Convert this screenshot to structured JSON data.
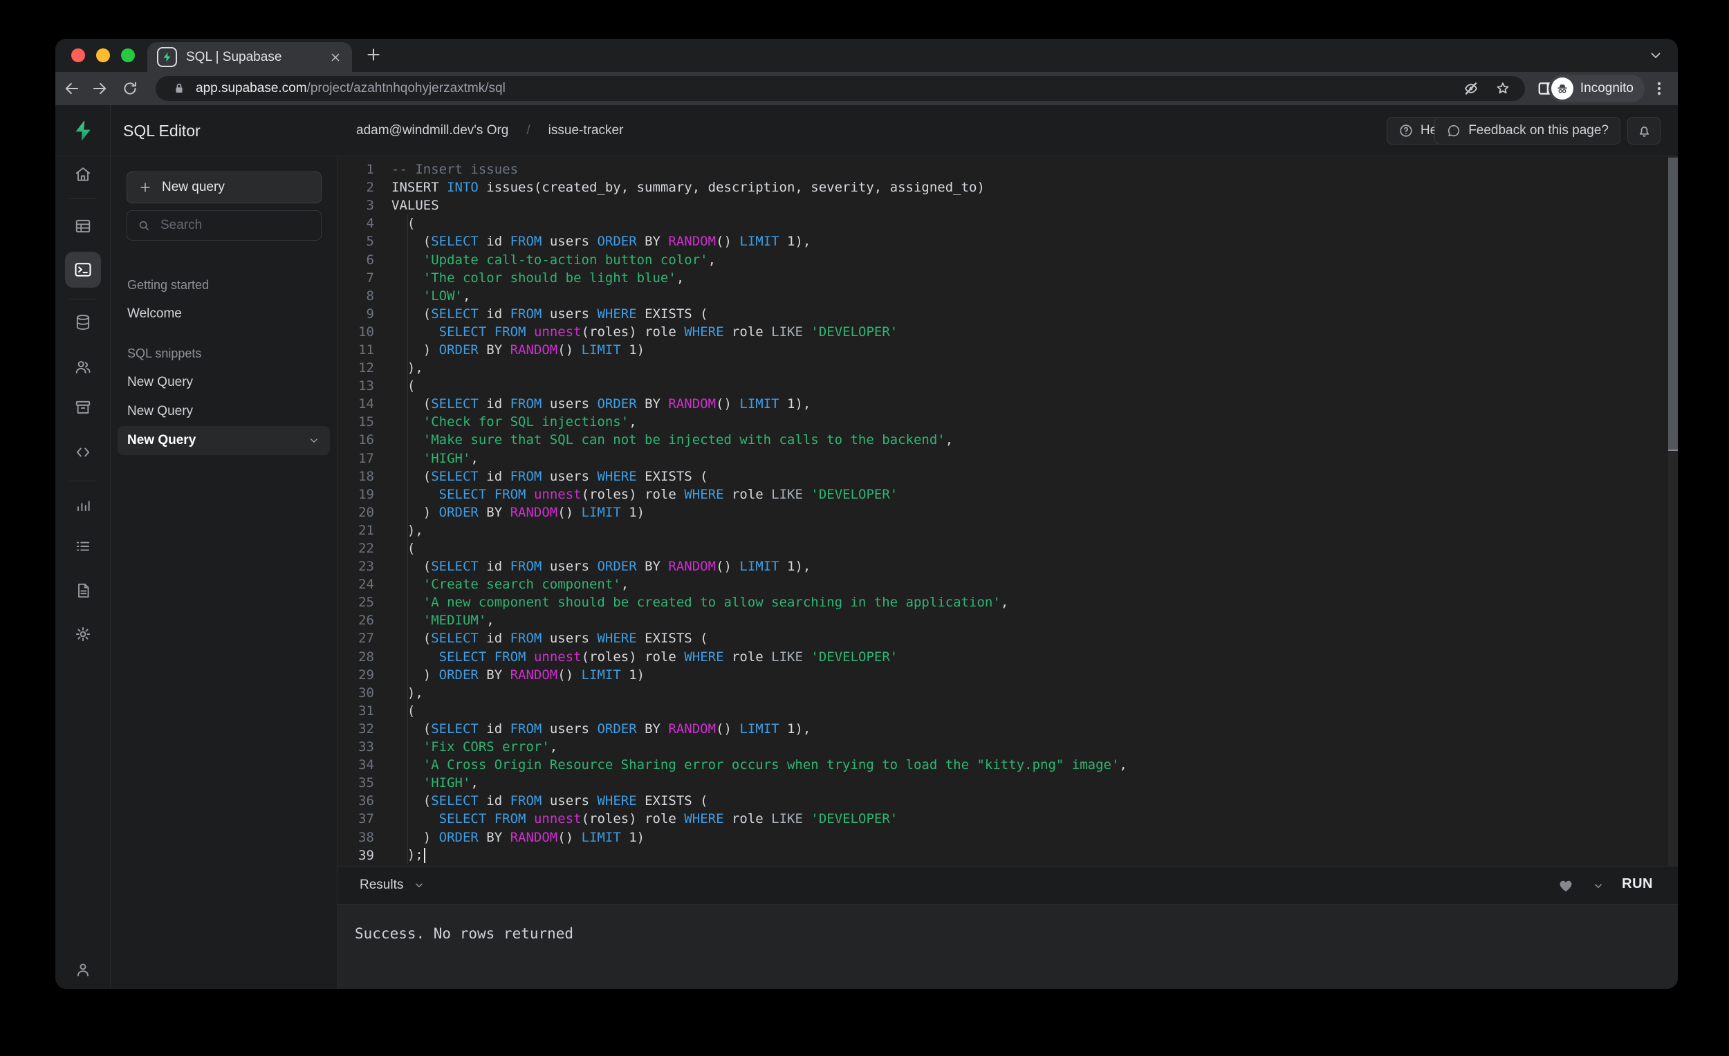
{
  "colors": {
    "brand_green": "#3ECF8E",
    "syntax_keyword": "#3E9EE6",
    "syntax_function": "#D02ED0",
    "syntax_string": "#2EB573",
    "syntax_comment": "#6B7480",
    "traffic_red": "#FF5F57",
    "traffic_yellow": "#FEBC2E",
    "traffic_green": "#28C840"
  },
  "browser": {
    "tab_title": "SQL | Supabase",
    "url_domain": "app.supabase.com",
    "url_path": "/project/azahtnhqohyjerzaxtmk/sql",
    "incognito_label": "Incognito",
    "icons": [
      "back-icon",
      "forward-icon",
      "reload-icon",
      "lock-icon",
      "eye-off-icon",
      "star-icon",
      "side-panel-icon",
      "incognito-icon",
      "kebab-menu-icon",
      "new-tab-icon",
      "tab-search-icon",
      "close-icon",
      "supabase-favicon"
    ]
  },
  "header": {
    "title": "SQL Editor",
    "breadcrumb_org": "adam@windmill.dev's Org",
    "breadcrumb_sep": "/",
    "breadcrumb_project": "issue-tracker",
    "help_label": "Help",
    "feedback_label": "Feedback on this page?",
    "icons": [
      "supabase-logo",
      "help-circle-icon",
      "chat-bubble-icon",
      "bell-icon"
    ]
  },
  "icon_rail": {
    "icons": [
      "home-icon",
      "table-editor-icon",
      "sql-editor-icon",
      "database-icon",
      "auth-users-icon",
      "storage-icon",
      "edge-functions-icon",
      "reports-icon",
      "logs-icon",
      "api-docs-icon",
      "settings-icon",
      "account-icon"
    ],
    "active": "sql-editor-icon"
  },
  "sidebar": {
    "new_query_label": "New query",
    "search_placeholder": "Search",
    "sections": [
      {
        "label": "Getting started",
        "items": [
          {
            "label": "Welcome",
            "active": false
          }
        ]
      },
      {
        "label": "SQL snippets",
        "items": [
          {
            "label": "New Query",
            "active": false
          },
          {
            "label": "New Query",
            "active": false
          },
          {
            "label": "New Query",
            "active": true
          }
        ]
      }
    ]
  },
  "editor": {
    "cursor_line": 39,
    "lines": [
      [
        [
          "c",
          "-- Insert issues"
        ]
      ],
      [
        [
          "p",
          "INSERT "
        ],
        [
          "k",
          "INTO"
        ],
        [
          "p",
          " issues(created_by, summary, description, severity, assigned_to)"
        ]
      ],
      [
        [
          "p",
          "VALUES"
        ]
      ],
      [
        [
          "p",
          "  ("
        ]
      ],
      [
        [
          "p",
          "    ("
        ],
        [
          "k",
          "SELECT"
        ],
        [
          "p",
          " id "
        ],
        [
          "k",
          "FROM"
        ],
        [
          "p",
          " users "
        ],
        [
          "k",
          "ORDER"
        ],
        [
          "p",
          " BY "
        ],
        [
          "f",
          "RANDOM"
        ],
        [
          "p",
          "() "
        ],
        [
          "k",
          "LIMIT"
        ],
        [
          "p",
          " 1),"
        ]
      ],
      [
        [
          "p",
          "    "
        ],
        [
          "s",
          "'Update call-to-action button color'"
        ],
        [
          "p",
          ","
        ]
      ],
      [
        [
          "p",
          "    "
        ],
        [
          "s",
          "'The color should be light blue'"
        ],
        [
          "p",
          ","
        ]
      ],
      [
        [
          "p",
          "    "
        ],
        [
          "s",
          "'LOW'"
        ],
        [
          "p",
          ","
        ]
      ],
      [
        [
          "p",
          "    ("
        ],
        [
          "k",
          "SELECT"
        ],
        [
          "p",
          " id "
        ],
        [
          "k",
          "FROM"
        ],
        [
          "p",
          " users "
        ],
        [
          "k",
          "WHERE"
        ],
        [
          "p",
          " EXISTS ("
        ]
      ],
      [
        [
          "p",
          "      "
        ],
        [
          "k",
          "SELECT"
        ],
        [
          "p",
          " "
        ],
        [
          "k",
          "FROM"
        ],
        [
          "p",
          " "
        ],
        [
          "f",
          "unnest"
        ],
        [
          "p",
          "(roles) role "
        ],
        [
          "k",
          "WHERE"
        ],
        [
          "p",
          " role "
        ],
        [
          "w",
          "LIKE"
        ],
        [
          "p",
          " "
        ],
        [
          "s",
          "'DEVELOPER'"
        ]
      ],
      [
        [
          "p",
          "    ) "
        ],
        [
          "k",
          "ORDER"
        ],
        [
          "p",
          " BY "
        ],
        [
          "f",
          "RANDOM"
        ],
        [
          "p",
          "() "
        ],
        [
          "k",
          "LIMIT"
        ],
        [
          "p",
          " 1)"
        ]
      ],
      [
        [
          "p",
          "  ),"
        ]
      ],
      [
        [
          "p",
          "  ("
        ]
      ],
      [
        [
          "p",
          "    ("
        ],
        [
          "k",
          "SELECT"
        ],
        [
          "p",
          " id "
        ],
        [
          "k",
          "FROM"
        ],
        [
          "p",
          " users "
        ],
        [
          "k",
          "ORDER"
        ],
        [
          "p",
          " BY "
        ],
        [
          "f",
          "RANDOM"
        ],
        [
          "p",
          "() "
        ],
        [
          "k",
          "LIMIT"
        ],
        [
          "p",
          " 1),"
        ]
      ],
      [
        [
          "p",
          "    "
        ],
        [
          "s",
          "'Check for SQL injections'"
        ],
        [
          "p",
          ","
        ]
      ],
      [
        [
          "p",
          "    "
        ],
        [
          "s",
          "'Make sure that SQL can not be injected with calls to the backend'"
        ],
        [
          "p",
          ","
        ]
      ],
      [
        [
          "p",
          "    "
        ],
        [
          "s",
          "'HIGH'"
        ],
        [
          "p",
          ","
        ]
      ],
      [
        [
          "p",
          "    ("
        ],
        [
          "k",
          "SELECT"
        ],
        [
          "p",
          " id "
        ],
        [
          "k",
          "FROM"
        ],
        [
          "p",
          " users "
        ],
        [
          "k",
          "WHERE"
        ],
        [
          "p",
          " EXISTS ("
        ]
      ],
      [
        [
          "p",
          "      "
        ],
        [
          "k",
          "SELECT"
        ],
        [
          "p",
          " "
        ],
        [
          "k",
          "FROM"
        ],
        [
          "p",
          " "
        ],
        [
          "f",
          "unnest"
        ],
        [
          "p",
          "(roles) role "
        ],
        [
          "k",
          "WHERE"
        ],
        [
          "p",
          " role "
        ],
        [
          "w",
          "LIKE"
        ],
        [
          "p",
          " "
        ],
        [
          "s",
          "'DEVELOPER'"
        ]
      ],
      [
        [
          "p",
          "    ) "
        ],
        [
          "k",
          "ORDER"
        ],
        [
          "p",
          " BY "
        ],
        [
          "f",
          "RANDOM"
        ],
        [
          "p",
          "() "
        ],
        [
          "k",
          "LIMIT"
        ],
        [
          "p",
          " 1)"
        ]
      ],
      [
        [
          "p",
          "  ),"
        ]
      ],
      [
        [
          "p",
          "  ("
        ]
      ],
      [
        [
          "p",
          "    ("
        ],
        [
          "k",
          "SELECT"
        ],
        [
          "p",
          " id "
        ],
        [
          "k",
          "FROM"
        ],
        [
          "p",
          " users "
        ],
        [
          "k",
          "ORDER"
        ],
        [
          "p",
          " BY "
        ],
        [
          "f",
          "RANDOM"
        ],
        [
          "p",
          "() "
        ],
        [
          "k",
          "LIMIT"
        ],
        [
          "p",
          " 1),"
        ]
      ],
      [
        [
          "p",
          "    "
        ],
        [
          "s",
          "'Create search component'"
        ],
        [
          "p",
          ","
        ]
      ],
      [
        [
          "p",
          "    "
        ],
        [
          "s",
          "'A new component should be created to allow searching in the application'"
        ],
        [
          "p",
          ","
        ]
      ],
      [
        [
          "p",
          "    "
        ],
        [
          "s",
          "'MEDIUM'"
        ],
        [
          "p",
          ","
        ]
      ],
      [
        [
          "p",
          "    ("
        ],
        [
          "k",
          "SELECT"
        ],
        [
          "p",
          " id "
        ],
        [
          "k",
          "FROM"
        ],
        [
          "p",
          " users "
        ],
        [
          "k",
          "WHERE"
        ],
        [
          "p",
          " EXISTS ("
        ]
      ],
      [
        [
          "p",
          "      "
        ],
        [
          "k",
          "SELECT"
        ],
        [
          "p",
          " "
        ],
        [
          "k",
          "FROM"
        ],
        [
          "p",
          " "
        ],
        [
          "f",
          "unnest"
        ],
        [
          "p",
          "(roles) role "
        ],
        [
          "k",
          "WHERE"
        ],
        [
          "p",
          " role "
        ],
        [
          "w",
          "LIKE"
        ],
        [
          "p",
          " "
        ],
        [
          "s",
          "'DEVELOPER'"
        ]
      ],
      [
        [
          "p",
          "    ) "
        ],
        [
          "k",
          "ORDER"
        ],
        [
          "p",
          " BY "
        ],
        [
          "f",
          "RANDOM"
        ],
        [
          "p",
          "() "
        ],
        [
          "k",
          "LIMIT"
        ],
        [
          "p",
          " 1)"
        ]
      ],
      [
        [
          "p",
          "  ),"
        ]
      ],
      [
        [
          "p",
          "  ("
        ]
      ],
      [
        [
          "p",
          "    ("
        ],
        [
          "k",
          "SELECT"
        ],
        [
          "p",
          " id "
        ],
        [
          "k",
          "FROM"
        ],
        [
          "p",
          " users "
        ],
        [
          "k",
          "ORDER"
        ],
        [
          "p",
          " BY "
        ],
        [
          "f",
          "RANDOM"
        ],
        [
          "p",
          "() "
        ],
        [
          "k",
          "LIMIT"
        ],
        [
          "p",
          " 1),"
        ]
      ],
      [
        [
          "p",
          "    "
        ],
        [
          "s",
          "'Fix CORS error'"
        ],
        [
          "p",
          ","
        ]
      ],
      [
        [
          "p",
          "    "
        ],
        [
          "s",
          "'A Cross Origin Resource Sharing error occurs when trying to load the \"kitty.png\" image'"
        ],
        [
          "p",
          ","
        ]
      ],
      [
        [
          "p",
          "    "
        ],
        [
          "s",
          "'HIGH'"
        ],
        [
          "p",
          ","
        ]
      ],
      [
        [
          "p",
          "    ("
        ],
        [
          "k",
          "SELECT"
        ],
        [
          "p",
          " id "
        ],
        [
          "k",
          "FROM"
        ],
        [
          "p",
          " users "
        ],
        [
          "k",
          "WHERE"
        ],
        [
          "p",
          " EXISTS ("
        ]
      ],
      [
        [
          "p",
          "      "
        ],
        [
          "k",
          "SELECT"
        ],
        [
          "p",
          " "
        ],
        [
          "k",
          "FROM"
        ],
        [
          "p",
          " "
        ],
        [
          "f",
          "unnest"
        ],
        [
          "p",
          "(roles) role "
        ],
        [
          "k",
          "WHERE"
        ],
        [
          "p",
          " role "
        ],
        [
          "w",
          "LIKE"
        ],
        [
          "p",
          " "
        ],
        [
          "s",
          "'DEVELOPER'"
        ]
      ],
      [
        [
          "p",
          "    ) "
        ],
        [
          "k",
          "ORDER"
        ],
        [
          "p",
          " BY "
        ],
        [
          "f",
          "RANDOM"
        ],
        [
          "p",
          "() "
        ],
        [
          "k",
          "LIMIT"
        ],
        [
          "p",
          " 1)"
        ]
      ],
      [
        [
          "p",
          "  );"
        ]
      ]
    ]
  },
  "results": {
    "tab_label": "Results",
    "run_label": "RUN",
    "message": "Success. No rows returned",
    "icons": [
      "heart-icon",
      "chevron-down-icon"
    ]
  }
}
